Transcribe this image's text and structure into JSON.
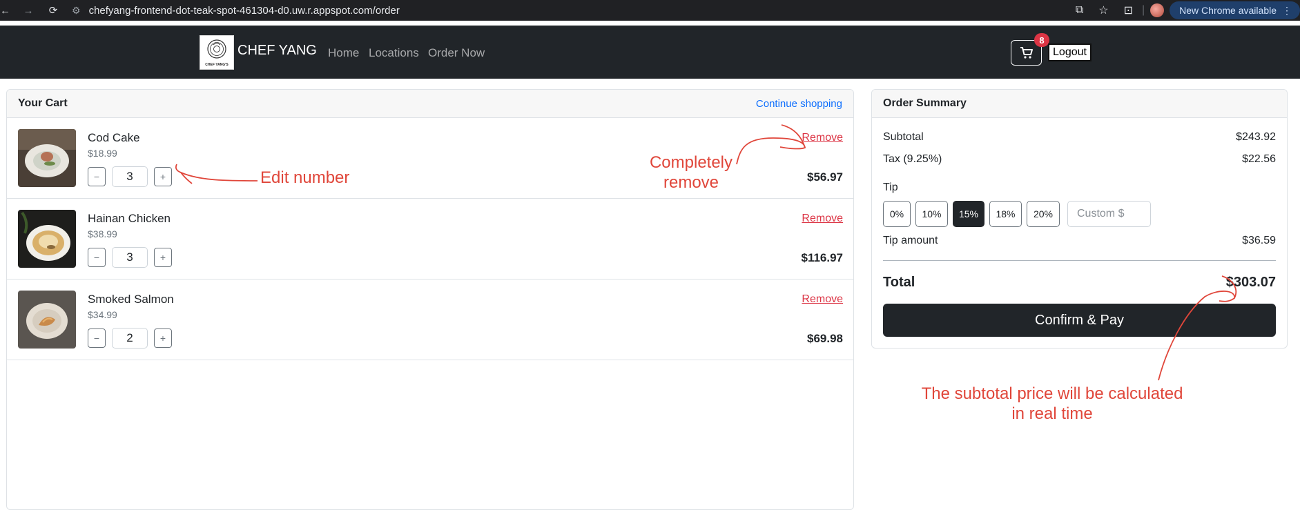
{
  "browser": {
    "url": "chefyang-frontend-dot-teak-spot-461304-d0.uw.r.appspot.com/order",
    "update_label": "New Chrome available"
  },
  "navbar": {
    "brand": "CHEF YANG",
    "logo_text": "CHEF YANG'S",
    "links": [
      "Home",
      "Locations",
      "Order Now"
    ],
    "cart_count": "8",
    "logout_label": "Logout"
  },
  "cart": {
    "title": "Your Cart",
    "continue_label": "Continue shopping",
    "remove_label": "Remove",
    "items": [
      {
        "name": "Cod Cake",
        "price": "$18.99",
        "qty": "3",
        "total": "$56.97"
      },
      {
        "name": "Hainan Chicken",
        "price": "$38.99",
        "qty": "3",
        "total": "$116.97"
      },
      {
        "name": "Smoked Salmon",
        "price": "$34.99",
        "qty": "2",
        "total": "$69.98"
      }
    ],
    "minus": "−",
    "plus": "+"
  },
  "summary": {
    "title": "Order Summary",
    "subtotal_label": "Subtotal",
    "subtotal": "$243.92",
    "tax_label": "Tax (9.25%)",
    "tax": "$22.56",
    "tip_label": "Tip",
    "tip_options": [
      "0%",
      "10%",
      "15%",
      "18%",
      "20%"
    ],
    "tip_selected": "15%",
    "custom_placeholder": "Custom $",
    "tip_amount_label": "Tip amount",
    "tip_amount": "$36.59",
    "total_label": "Total",
    "total": "$303.07",
    "pay_label": "Confirm & Pay"
  },
  "annotations": {
    "edit_number": "Edit number",
    "remove_line1": "Completely",
    "remove_line2": "remove",
    "subtotal_line1": "The subtotal price will be calculated",
    "subtotal_line2": "in real time"
  },
  "colors": {
    "navbar": "#212529",
    "remove": "#dc3545",
    "link": "#0d6efd",
    "annotation": "#e0463a",
    "badge": "#dc3545"
  }
}
